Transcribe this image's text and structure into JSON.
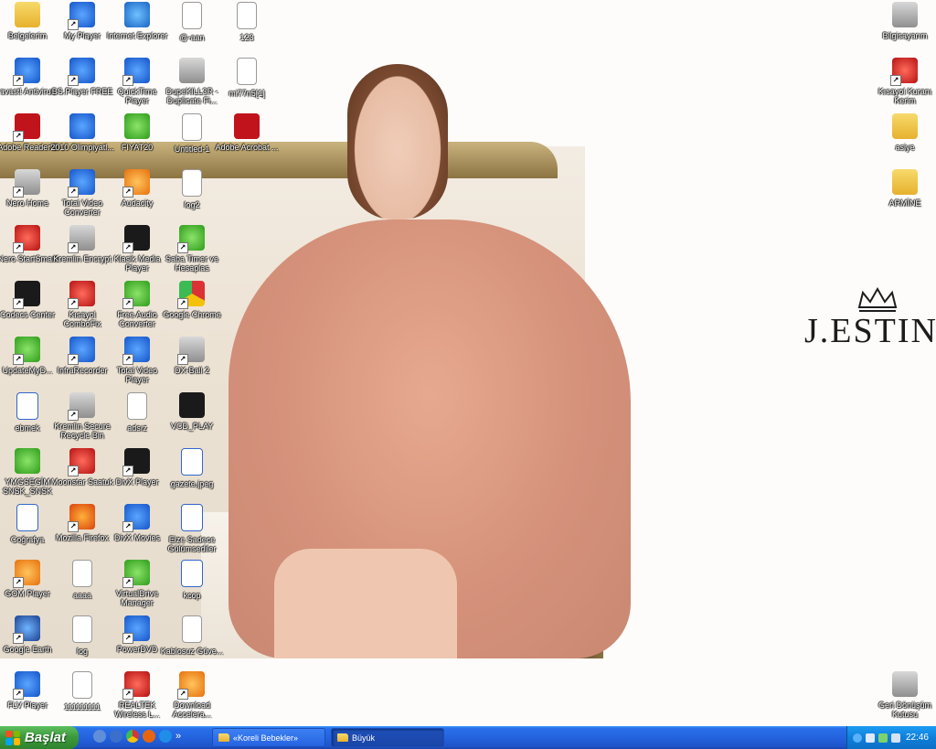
{
  "wallpaper": {
    "brand": "J.ESTINA"
  },
  "icons": [
    {
      "label": "Belgelerim",
      "glyph": "folder",
      "col": 0,
      "row": 0
    },
    {
      "label": "My Player",
      "glyph": "blue",
      "col": 1,
      "row": 0,
      "shortcut": true
    },
    {
      "label": "Internet Explorer",
      "glyph": "ie",
      "col": 2,
      "row": 0
    },
    {
      "label": "@-aan",
      "glyph": "doc",
      "col": 3,
      "row": 0
    },
    {
      "label": "123",
      "glyph": "doc",
      "col": 4,
      "row": 0
    },
    {
      "label": "Bilgisayarım",
      "glyph": "gray",
      "col": "right",
      "row": 0
    },
    {
      "label": "avast! Antivirus",
      "glyph": "blue",
      "col": 0,
      "row": 1,
      "shortcut": true
    },
    {
      "label": "BS.Player FREE",
      "glyph": "blue",
      "col": 1,
      "row": 1,
      "shortcut": true
    },
    {
      "label": "QuickTime Player",
      "glyph": "blue",
      "col": 2,
      "row": 1,
      "shortcut": true
    },
    {
      "label": "DupeKILL3R - Duplicate Fi...",
      "glyph": "gray",
      "col": 3,
      "row": 1
    },
    {
      "label": "mi77n5[1]",
      "glyph": "doc",
      "col": 4,
      "row": 1
    },
    {
      "label": "Kısayol Kuranı Kerim",
      "glyph": "red",
      "col": "right",
      "row": 1,
      "shortcut": true
    },
    {
      "label": "Adobe Reader 9",
      "glyph": "pdf",
      "col": 0,
      "row": 2,
      "shortcut": true
    },
    {
      "label": "2010 Olimpiyatl...",
      "glyph": "blue",
      "col": 1,
      "row": 2
    },
    {
      "label": "FIYAT20",
      "glyph": "green",
      "col": 2,
      "row": 2
    },
    {
      "label": "Untitled-1",
      "glyph": "doc",
      "col": 3,
      "row": 2
    },
    {
      "label": "Adobe Acrobat ...",
      "glyph": "pdf",
      "col": 4,
      "row": 2
    },
    {
      "label": "asiye",
      "glyph": "folder",
      "col": "right",
      "row": 2
    },
    {
      "label": "Nero Home",
      "glyph": "gray",
      "col": 0,
      "row": 3,
      "shortcut": true
    },
    {
      "label": "Total Video Converter",
      "glyph": "blue",
      "col": 1,
      "row": 3,
      "shortcut": true
    },
    {
      "label": "Audacity",
      "glyph": "orange",
      "col": 2,
      "row": 3,
      "shortcut": true
    },
    {
      "label": "log2",
      "glyph": "doc",
      "col": 3,
      "row": 3
    },
    {
      "label": "ARMİNE",
      "glyph": "folder",
      "col": "right",
      "row": 3
    },
    {
      "label": "Nero StartSmart",
      "glyph": "red",
      "col": 0,
      "row": 4,
      "shortcut": true
    },
    {
      "label": "Kremlin Encrypt",
      "glyph": "gray",
      "col": 1,
      "row": 4,
      "shortcut": true
    },
    {
      "label": "Klasik Media Player",
      "glyph": "black",
      "col": 2,
      "row": 4,
      "shortcut": true
    },
    {
      "label": "Saba Timer ve Hesaplas",
      "glyph": "green",
      "col": 3,
      "row": 4,
      "shortcut": true
    },
    {
      "label": "Codecs Center",
      "glyph": "black",
      "col": 0,
      "row": 5,
      "shortcut": true
    },
    {
      "label": "Kısayol ComboFix",
      "glyph": "red",
      "col": 1,
      "row": 5,
      "shortcut": true
    },
    {
      "label": "Free Audio Converter",
      "glyph": "green",
      "col": 2,
      "row": 5,
      "shortcut": true
    },
    {
      "label": "Google Chrome",
      "glyph": "chrome",
      "col": 3,
      "row": 5,
      "shortcut": true
    },
    {
      "label": "UpdateMyD...",
      "glyph": "green",
      "col": 0,
      "row": 6,
      "shortcut": true
    },
    {
      "label": "InfraRecorder",
      "glyph": "blue",
      "col": 1,
      "row": 6,
      "shortcut": true
    },
    {
      "label": "Total Video Player",
      "glyph": "blue",
      "col": 2,
      "row": 6,
      "shortcut": true
    },
    {
      "label": "DX-Ball 2",
      "glyph": "gray",
      "col": 3,
      "row": 6,
      "shortcut": true
    },
    {
      "label": "ebmek",
      "glyph": "word",
      "col": 0,
      "row": 7
    },
    {
      "label": "Kremlin Secure Recycle Bin",
      "glyph": "gray",
      "col": 1,
      "row": 7,
      "shortcut": true
    },
    {
      "label": "adsız",
      "glyph": "doc",
      "col": 2,
      "row": 7
    },
    {
      "label": "VCD_PLAY",
      "glyph": "black",
      "col": 3,
      "row": 7
    },
    {
      "label": "YMGSEGİM SNSK_SNSK",
      "glyph": "green",
      "col": 0,
      "row": 8
    },
    {
      "label": "Moonstar Saatuk",
      "glyph": "red",
      "col": 1,
      "row": 8,
      "shortcut": true
    },
    {
      "label": "DivX Player",
      "glyph": "black",
      "col": 2,
      "row": 8,
      "shortcut": true
    },
    {
      "label": "gazete.jpeg",
      "glyph": "word",
      "col": 3,
      "row": 8
    },
    {
      "label": "Coğrafya",
      "glyph": "word",
      "col": 0,
      "row": 9
    },
    {
      "label": "Mozilla Firefox",
      "glyph": "firefox",
      "col": 1,
      "row": 9,
      "shortcut": true
    },
    {
      "label": "DivX Movies",
      "glyph": "blue",
      "col": 2,
      "row": 9,
      "shortcut": true
    },
    {
      "label": "Elze Sadece Gülümsediler",
      "glyph": "word",
      "col": 3,
      "row": 9
    },
    {
      "label": "GOM Player",
      "glyph": "orange",
      "col": 0,
      "row": 10,
      "shortcut": true
    },
    {
      "label": "aaaa",
      "glyph": "doc",
      "col": 1,
      "row": 10
    },
    {
      "label": "VirtualDrive Manager",
      "glyph": "green",
      "col": 2,
      "row": 10,
      "shortcut": true
    },
    {
      "label": "kcop",
      "glyph": "word",
      "col": 3,
      "row": 10
    },
    {
      "label": "Google Earth",
      "glyph": "earth",
      "col": 0,
      "row": 11,
      "shortcut": true
    },
    {
      "label": "log",
      "glyph": "doc",
      "col": 1,
      "row": 11
    },
    {
      "label": "PowerDVD",
      "glyph": "blue",
      "col": 2,
      "row": 11,
      "shortcut": true
    },
    {
      "label": "Kablosuz Güve...",
      "glyph": "doc",
      "col": 3,
      "row": 11
    },
    {
      "label": "FLV Player",
      "glyph": "blue",
      "col": 0,
      "row": 12,
      "shortcut": true
    },
    {
      "label": "111111111",
      "glyph": "doc",
      "col": 1,
      "row": 12
    },
    {
      "label": "REALTEK Wireless L...",
      "glyph": "red",
      "col": 2,
      "row": 12,
      "shortcut": true
    },
    {
      "label": "Download Accelera...",
      "glyph": "orange",
      "col": 3,
      "row": 12,
      "shortcut": true
    },
    {
      "label": "Geri Dönüşüm Kutusu",
      "glyph": "gray",
      "col": "right",
      "row": 12
    }
  ],
  "taskbar": {
    "start_label": "Başlat",
    "quick_launch": [
      "show-desktop-icon",
      "media-icon",
      "chrome-icon",
      "firefox-icon",
      "ie-icon"
    ],
    "more_label": "»",
    "tasks": [
      {
        "label": "«Koreli Bebekler»",
        "active": false
      },
      {
        "label": "Büyük",
        "active": true
      }
    ],
    "clock": "22:46"
  },
  "colors": {
    "taskbar": "#2463de",
    "start": "#3c9a3c",
    "tray": "#0f7fda"
  }
}
